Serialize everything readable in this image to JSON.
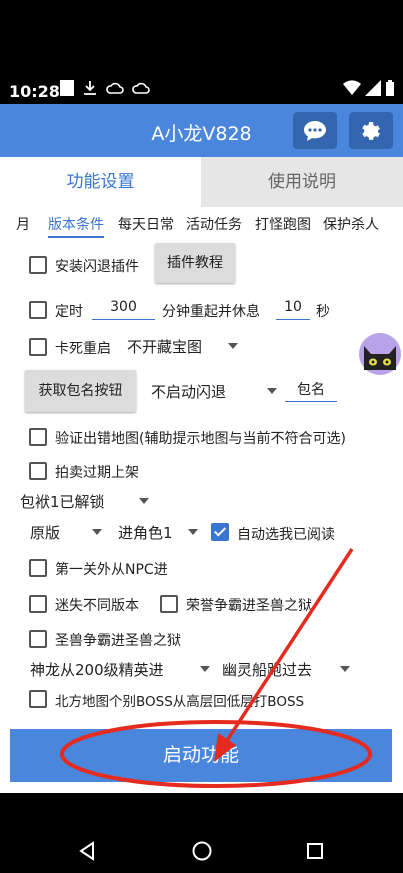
{
  "status": {
    "time": "10:28"
  },
  "app": {
    "title": "A小龙V828"
  },
  "tabs": {
    "active": "功能设置",
    "inactive": "使用说明"
  },
  "subtabs": [
    "月",
    "版本条件",
    "每天日常",
    "活动任务",
    "打怪跑图",
    "保护杀人"
  ],
  "options": {
    "install_flashback": "安装闪退插件",
    "plugin_tutorial": "插件教程",
    "timer_label": "定时",
    "timer_value": "300",
    "timer_mid": "分钟重起并休息",
    "rest_value": "10",
    "seconds": "秒",
    "stuck_restart": "卡死重启",
    "treasure_map_select": "不开藏宝图",
    "get_package_btn": "获取包名按钮",
    "flashback_select": "不启动闪退",
    "package_name": "包名",
    "verify_map": "验证出错地图(辅助提示地图与当前不符合可选)",
    "auction_relist": "拍卖过期上架",
    "bag_unlocked": "包袱1已解锁",
    "version_select": "原版",
    "character_select": "进角色1",
    "auto_read": "自动选我已阅读",
    "first_level_npc": "第一关外从NPC进",
    "maze_versions": "迷失不同版本",
    "honor_prison": "荣誉争霸进圣兽之狱",
    "holy_prison": "圣兽争霸进圣兽之狱",
    "dragon_select": "神龙从200级精英进",
    "ghost_ship_select": "幽灵船跑过去",
    "north_boss": "北方地图个别BOSS从高层回低层打BOSS"
  },
  "start_button": "启动功能",
  "colors": {
    "accent": "#4a86dc",
    "dark_accent": "#3466b0",
    "annotation": "#e52b1f"
  }
}
